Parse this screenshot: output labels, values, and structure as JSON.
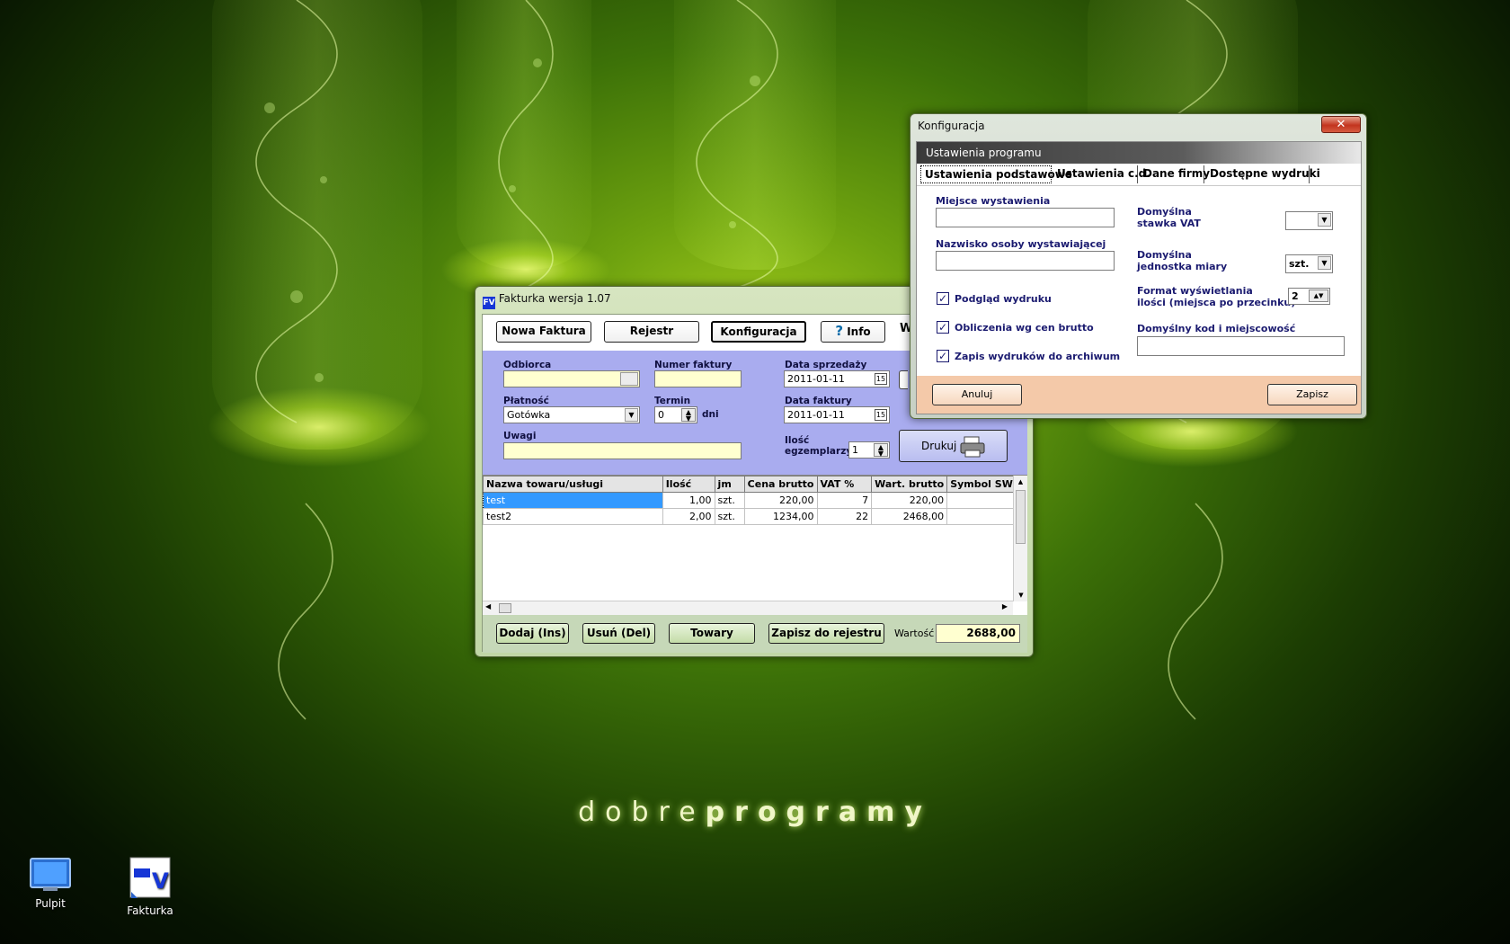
{
  "desktop": {
    "brand_light": "dobre",
    "brand_bold": "programy",
    "icons": [
      {
        "label": "Pulpit",
        "icon": "monitor-icon"
      },
      {
        "label": "Fakturka",
        "icon": "fakturka-app-icon"
      }
    ]
  },
  "fakturka": {
    "title": "Fakturka  wersja 1.07",
    "toolbar": {
      "new_invoice": "Nowa Faktura",
      "register": "Rejestr",
      "config": "Konfiguracja",
      "info": "Info",
      "clipped": "W"
    },
    "form": {
      "recipient_label": "Odbiorca",
      "recipient_value": "",
      "invoice_number_label": "Numer faktury",
      "invoice_number_value": "",
      "sale_date_label": "Data sprzedaży",
      "sale_date_value": "2011-01-11",
      "payment_label": "Płatność",
      "payment_value": "Gotówka",
      "term_label": "Termin",
      "term_value": "0",
      "term_unit": "dni",
      "invoice_date_label": "Data faktury",
      "invoice_date_value": "2011-01-11",
      "notes_label": "Uwagi",
      "notes_value": "",
      "copies_label_1": "Ilość",
      "copies_label_2": "egzemplarzy",
      "copies_value": "1",
      "print_button": "Drukuj"
    },
    "table": {
      "columns": [
        "Nazwa towaru/usługi",
        "Ilość",
        "jm",
        "Cena brutto",
        "VAT %",
        "Wart. brutto",
        "Symbol SWW"
      ],
      "rows": [
        [
          "test",
          "1,00",
          "szt.",
          "220,00",
          "7",
          "220,00",
          ""
        ],
        [
          "test2",
          "2,00",
          "szt.",
          "1234,00",
          "22",
          "2468,00",
          ""
        ]
      ]
    },
    "bottom": {
      "add": "Dodaj (Ins)",
      "delete": "Usuń (Del)",
      "goods": "Towary",
      "save_register": "Zapisz do rejestru",
      "value_label": "Wartość",
      "value": "2688,00"
    }
  },
  "konfiguracja": {
    "title": "Konfiguracja",
    "close": "✕",
    "header": "Ustawienia programu",
    "tabs": [
      "Ustawienia podstawowe",
      "Ustawienia c.d.",
      "Dane firmy",
      "Dostępne wydruki"
    ],
    "place_label": "Miejsce wystawienia",
    "place_value": "",
    "issuer_label": "Nazwisko osoby wystawiającej",
    "issuer_value": "",
    "vat_label_1": "Domyślna",
    "vat_label_2": "stawka VAT",
    "vat_value": "",
    "unit_label_1": "Domyślna",
    "unit_label_2": "jednostka miary",
    "unit_value": "szt.",
    "format_label_1": "Format wyświetlania",
    "format_label_2": "ilości (miejsca po przecinku)",
    "format_value": "2",
    "preview_label": "Podgląd wydruku",
    "gross_label": "Obliczenia wg cen brutto",
    "archive_label": "Zapis wydruków do archiwum",
    "contractor_label": "Domyślny kod i miejscowość kontrahenta",
    "contractor_value": "",
    "cancel": "Anuluj",
    "save": "Zapisz"
  }
}
